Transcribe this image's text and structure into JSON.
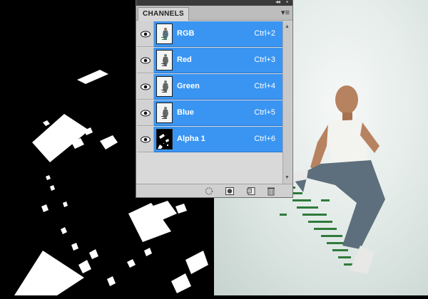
{
  "panel": {
    "tab_label": "CHANNELS",
    "collapse_glyph": "◂◂",
    "close_glyph": "▪",
    "menu_glyph": "▾≡"
  },
  "channels": [
    {
      "name": "RGB",
      "shortcut": "Ctrl+2",
      "thumb": "composite"
    },
    {
      "name": "Red",
      "shortcut": "Ctrl+3",
      "thumb": "composite"
    },
    {
      "name": "Green",
      "shortcut": "Ctrl+4",
      "thumb": "composite"
    },
    {
      "name": "Blue",
      "shortcut": "Ctrl+5",
      "thumb": "composite"
    },
    {
      "name": "Alpha 1",
      "shortcut": "Ctrl+6",
      "thumb": "mask"
    }
  ],
  "footer_buttons": [
    {
      "icon": "load-channel-as-selection-icon"
    },
    {
      "icon": "save-selection-as-channel-icon"
    },
    {
      "icon": "create-new-channel-icon"
    },
    {
      "icon": "delete-channel-icon"
    }
  ],
  "colors": {
    "selected_row": "#3a95f2",
    "panel_bg": "#d6d6d6"
  }
}
